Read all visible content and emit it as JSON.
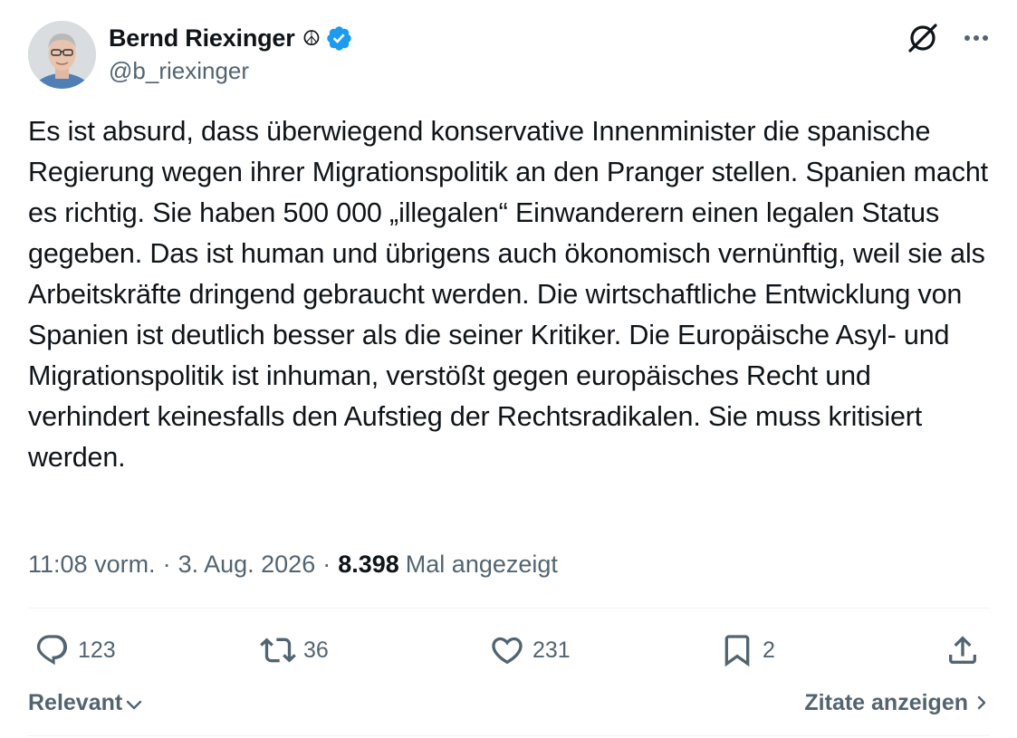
{
  "author": {
    "name": "Bernd Riexinger",
    "name_emoji": "☮",
    "handle": "@b_riexinger",
    "verified_color": "#1d9bf0"
  },
  "icons": {
    "grok": "grok-icon",
    "more": "more-options-icon",
    "reply": "reply-icon",
    "repost": "repost-icon",
    "like": "like-icon",
    "bookmark": "bookmark-icon",
    "share": "share-icon"
  },
  "tweet": {
    "text": "Es ist absurd, dass überwiegend konservative Innenminister die spanische Regierung wegen ihrer Migrationspolitik an den Pranger stellen. Spanien macht es richtig. Sie haben 500 000 „illegalen“ Einwanderern einen legalen Status gegeben. Das ist human und übrigens auch ökonomisch vernünftig, weil sie als Arbeitskräfte dringend gebraucht werden. Die wirtschaftliche Entwicklung von Spanien ist deutlich besser als die seiner Kritiker. Die Europäische Asyl- und Migrationspolitik ist inhuman, verstößt gegen europäisches Recht und verhindert keinesfalls den Aufstieg der Rechtsradikalen. Sie muss kritisiert werden.",
    "time": "11:08 vorm.",
    "separator": "·",
    "date": "3. Aug. 2026",
    "views_count": "8.398",
    "views_label": "Mal angezeigt"
  },
  "actions": {
    "replies": "123",
    "reposts": "36",
    "likes": "231",
    "bookmarks": "2"
  },
  "footer": {
    "sort_label": "Relevant",
    "quotes_label": "Zitate anzeigen",
    "chevron_down": "⌄",
    "chevron_right": "›"
  },
  "colors": {
    "text": "#0f1419",
    "secondary": "#536471",
    "accent": "#1d9bf0"
  }
}
